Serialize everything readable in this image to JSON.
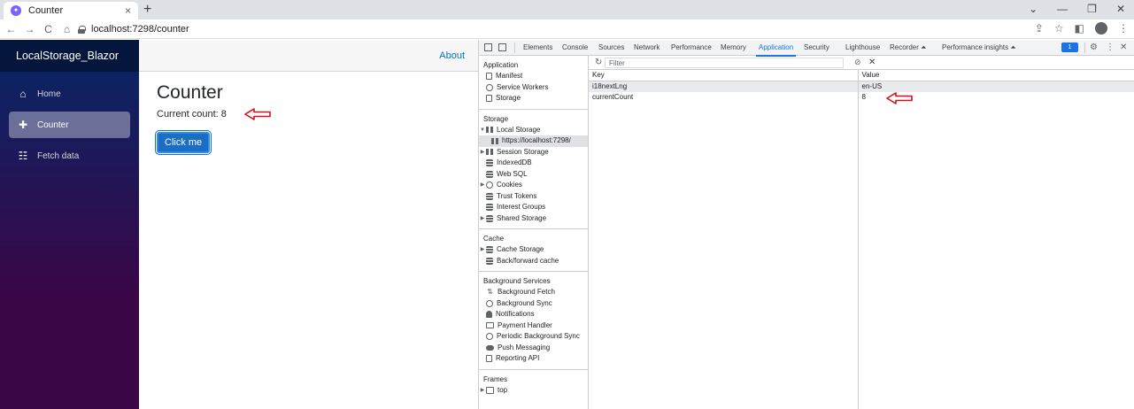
{
  "browser": {
    "tab_title": "Counter",
    "tab_close": "×",
    "new_tab": "+",
    "url": "localhost:7298/counter",
    "nav_back": "←",
    "nav_forward": "→",
    "nav_reload": "C",
    "nav_home": "⌂",
    "win_minimize": "⌄",
    "win_min": "—",
    "win_restore": "❐",
    "win_close": "✕",
    "share": "⇪",
    "star": "☆",
    "side_panel": "◧",
    "menu": "⋮"
  },
  "app": {
    "brand": "LocalStorage_Blazor",
    "nav_items": [
      {
        "label": "Home",
        "icon": "home-icon",
        "glyph": "⌂"
      },
      {
        "label": "Counter",
        "icon": "plus-icon",
        "glyph": "✚"
      },
      {
        "label": "Fetch data",
        "icon": "list-icon",
        "glyph": "☷"
      }
    ],
    "about": "About",
    "page_title": "Counter",
    "current_count": "Current count: 8",
    "button_label": "Click me"
  },
  "devtools": {
    "tabs": [
      "Elements",
      "Console",
      "Sources",
      "Network",
      "Performance",
      "Memory",
      "Application",
      "Security",
      "Lighthouse",
      "Recorder ⏶",
      "Performance insights ⏶"
    ],
    "selected_tab": "Application",
    "badge": "1",
    "settings_glyph": "⚙",
    "more_glyph": "⋮",
    "close_glyph": "✕",
    "sections": {
      "application": {
        "title": "Application",
        "items": [
          "Manifest",
          "Service Workers",
          "Storage"
        ]
      },
      "storage": {
        "title": "Storage",
        "local_storage": "Local Storage",
        "local_origin": "https://localhost:7298/",
        "items": [
          "Session Storage",
          "IndexedDB",
          "Web SQL",
          "Cookies",
          "Trust Tokens",
          "Interest Groups",
          "Shared Storage"
        ]
      },
      "cache": {
        "title": "Cache",
        "items": [
          "Cache Storage",
          "Back/forward cache"
        ]
      },
      "background": {
        "title": "Background Services",
        "items": [
          "Background Fetch",
          "Background Sync",
          "Notifications",
          "Payment Handler",
          "Periodic Background Sync",
          "Push Messaging",
          "Reporting API"
        ]
      },
      "frames": {
        "title": "Frames",
        "items": [
          "top"
        ]
      }
    },
    "filter_placeholder": "Filter",
    "refresh_glyph": "↻",
    "clear_glyph": "⃠",
    "delete_glyph": "✕",
    "table": {
      "headers": [
        "Key",
        "Value"
      ],
      "rows": [
        {
          "key": "i18nextLng",
          "value": "en-US"
        },
        {
          "key": "currentCount",
          "value": "8"
        }
      ]
    }
  },
  "colors": {
    "annotation_arrow": "#d6101a",
    "accent": "#1a73e8",
    "blazor_primary": "#1b6ec2"
  }
}
